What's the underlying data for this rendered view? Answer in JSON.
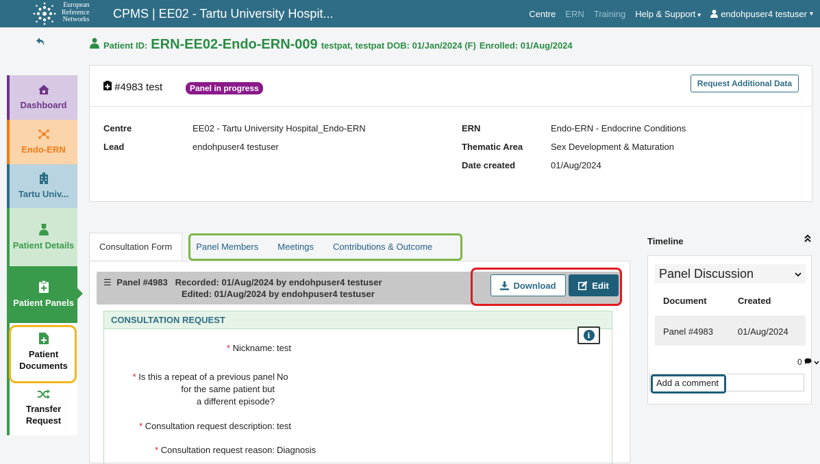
{
  "nav": {
    "logo_text": [
      "European",
      "Reference",
      "Networks"
    ],
    "title": "CPMS | EE02 - Tartu University Hospit...",
    "links": [
      "Centre",
      "ERN",
      "Training"
    ],
    "help": "Help & Support",
    "user": "endohpuser4 testuser"
  },
  "patient": {
    "id_label": "Patient ID:",
    "id": "ERN-EE02-Endo-ERN-009",
    "details": "testpat, testpat DOB: 01/Jan/2024 (F)",
    "enrolled": "Enrolled: 01/Aug/2024"
  },
  "sidebar": {
    "items": [
      {
        "label": "Dashboard",
        "icon": "home-icon"
      },
      {
        "label": "Endo-ERN",
        "icon": "network-icon"
      },
      {
        "label": "Tartu Univ...",
        "icon": "building-icon"
      },
      {
        "label": "Patient Details",
        "icon": "patient-icon"
      },
      {
        "label": "Patient Panels",
        "icon": "clipboard-plus-icon"
      },
      {
        "label": "Patient Documents",
        "icon": "document-plus-icon"
      },
      {
        "label": "Transfer Request",
        "icon": "shuffle-icon"
      }
    ]
  },
  "panel": {
    "case_id": "#4983 test",
    "status": "Panel in progress",
    "request_button": "Request Additional Data",
    "info": {
      "centre_label": "Centre",
      "centre": "EE02 - Tartu University Hospital_Endo-ERN",
      "lead_label": "Lead",
      "lead": "endohpuser4 testuser",
      "ern_label": "ERN",
      "ern": "Endo-ERN - Endocrine Conditions",
      "thematic_label": "Thematic Area",
      "thematic": "Sex Development & Maturation",
      "date_label": "Date created",
      "date": "01/Aug/2024"
    }
  },
  "tabs": [
    "Consultation Form",
    "Panel Members",
    "Meetings",
    "Contributions & Outcome"
  ],
  "form": {
    "panel_name": "Panel #4983",
    "recorded": "Recorded: 01/Aug/2024 by endohpuser4 testuser",
    "edited": "Edited: 01/Aug/2024 by endohpuser4 testuser",
    "download": "Download",
    "edit": "Edit",
    "section_title": "CONSULTATION REQUEST",
    "fields": [
      {
        "label": "Nickname:",
        "value": "test"
      },
      {
        "label_lines": [
          "Is this a repeat of a previous panel",
          "for the same patient but",
          "a different episode?"
        ],
        "value": "No"
      },
      {
        "label": "Consultation request description:",
        "value": "test"
      },
      {
        "label": "Consultation request reason:",
        "value": "Diagnosis"
      }
    ]
  },
  "timeline": {
    "title": "Timeline",
    "discussion": "Panel Discussion",
    "col_document": "Document",
    "col_created": "Created",
    "row_document": "Panel #4983",
    "row_created": "01/Aug/2024",
    "comment_count": "0",
    "comment_placeholder": "Add a comment"
  },
  "colors": {
    "topbar": "#2e6d85",
    "patient_green": "#2a8c45",
    "status_badge": "#8a1a8a",
    "highlight_red": "#e0191f",
    "highlight_green": "#7cb648",
    "highlight_yellow": "#f2b61d",
    "highlight_teal": "#1e5e79"
  }
}
